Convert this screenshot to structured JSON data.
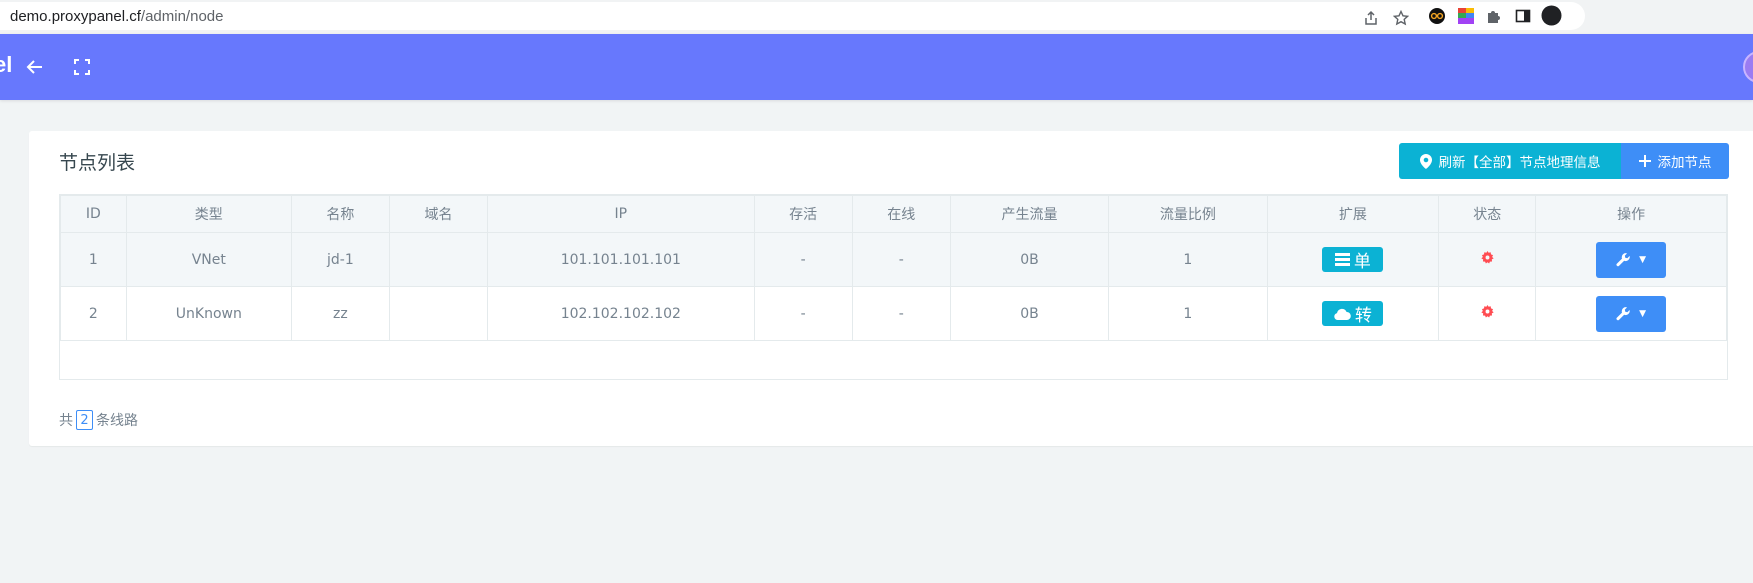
{
  "browser": {
    "url_host": "demo.proxypanel.cf",
    "url_path": "/admin/node"
  },
  "navbar": {
    "brand": "el"
  },
  "panel": {
    "title": "节点列表",
    "refresh_geo_button": "刷新【全部】节点地理信息",
    "add_node_button": "添加节点"
  },
  "table": {
    "headers": [
      "ID",
      "类型",
      "名称",
      "域名",
      "IP",
      "存活",
      "在线",
      "产生流量",
      "流量比例",
      "扩展",
      "状态",
      "操作"
    ],
    "rows": [
      {
        "id": "1",
        "type": "VNet",
        "name": "jd-1",
        "domain": "",
        "ip": "101.101.101.101",
        "alive": "-",
        "online": "-",
        "traffic": "0B",
        "ratio": "1",
        "ext_icon": "bars-icon",
        "ext_label": "单",
        "status_icon": "gear-icon"
      },
      {
        "id": "2",
        "type": "UnKnown",
        "name": "zz",
        "domain": "",
        "ip": "102.102.102.102",
        "alive": "-",
        "online": "-",
        "traffic": "0B",
        "ratio": "1",
        "ext_icon": "cloud-icon",
        "ext_label": "转",
        "status_icon": "gear-icon"
      }
    ]
  },
  "summary": {
    "prefix": "共",
    "count": "2",
    "suffix": "条线路"
  },
  "colors": {
    "navbar": "#6778fd",
    "info": "#0bb2d4",
    "primary": "#3e8ef7",
    "danger": "#ff4c52"
  }
}
